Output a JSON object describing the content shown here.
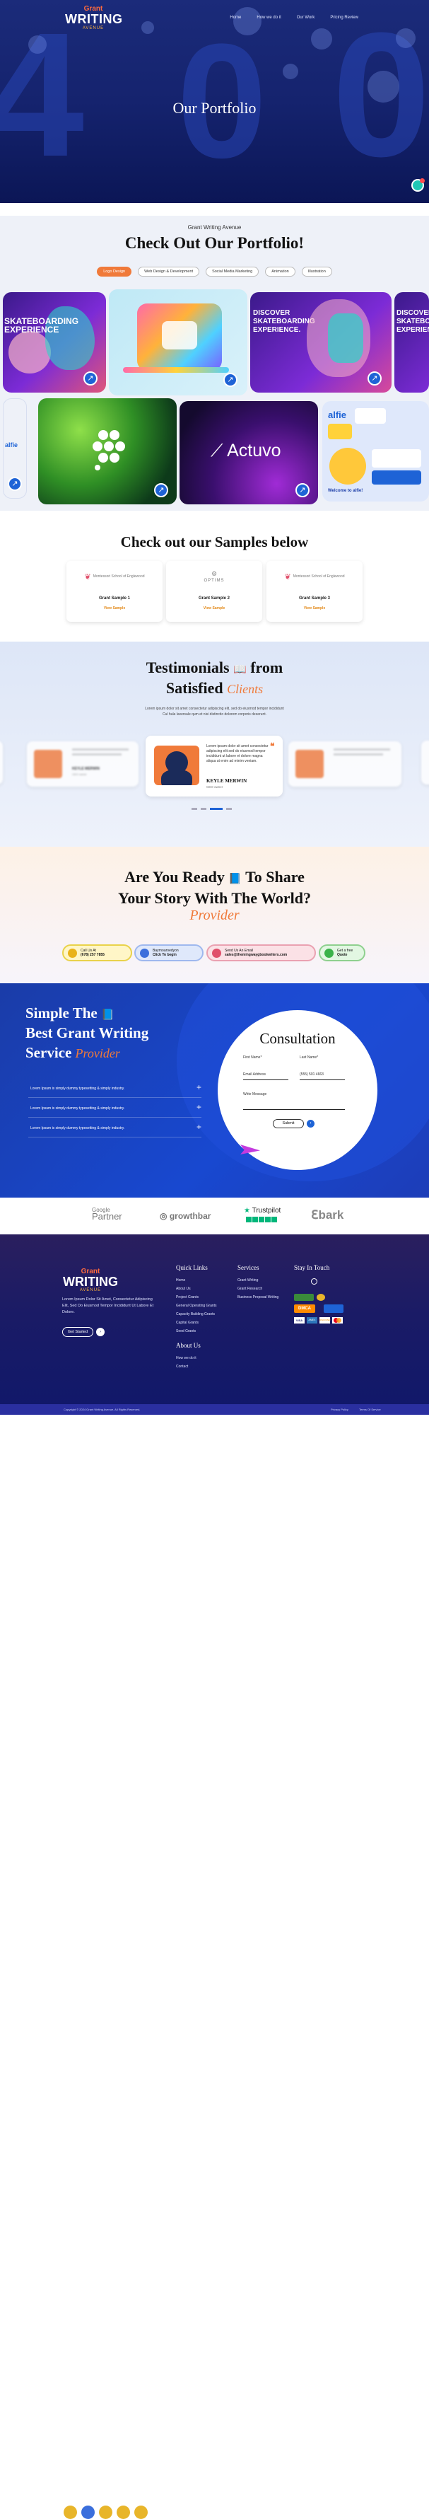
{
  "header": {
    "logo": {
      "line1": "Grant",
      "line2": "WRITING",
      "line3": "AVENUE"
    },
    "nav": [
      "Home",
      "How we do it",
      "Our Work",
      "Pricing Review"
    ],
    "title": "Our Portfolio"
  },
  "portfolio": {
    "eyebrow": "Grant Writing Avenue",
    "title": "Check Out Our Portfolio!",
    "filters": [
      "Logo Design",
      "Web Design & Development",
      "Social Media Marketing",
      "Animation",
      "Illustration"
    ],
    "active_filter": "Logo Design",
    "cards": {
      "skate_text": "DISCOVER SKATEBOARDING EXPERIENCE.",
      "skate_text_small": "SKATEBOARDING EXPERIENCE",
      "actuvo": "Actuvo",
      "alfie": "alfie",
      "alfie_side": "alfie",
      "welcome": "Welcome to alfie!"
    }
  },
  "samples": {
    "title": "Check out our Samples below",
    "items": [
      {
        "name": "Grant Sample 1",
        "link": "View Sample",
        "logo_text": "Montessori School of Englewood"
      },
      {
        "name": "Grant Sample 2",
        "link": "View Sample",
        "logo_text": "OPTIMS"
      },
      {
        "name": "Grant Sample 3",
        "link": "View Sample",
        "logo_text": "Montessori School of Englewood"
      }
    ]
  },
  "testimonials": {
    "title_line1": "Testimonials",
    "title_line1b": "from",
    "title_line2": "Satisfied",
    "script_word": "Clients",
    "intro_line1": "Lorem ipsum dolor sit amet consectetur adipiscing elit, sed do eiusmod tempor incididunt",
    "intro_line2": "Cul hula laversale qum et nisi distinctio dolorem corporis deserunt.",
    "featured": {
      "text": "Lorem ipsum dolor sit amet consectetur adipiscing elit sed do eiusmod tempor incididunt ut labore et dolore magna aliqua ut enim ad minim veniam.",
      "name": "KEYLE MERWIN",
      "role": "CEO owner"
    },
    "side_name": "KEYLE MERWIN",
    "side_role": "CEO owner",
    "dots_active": 2
  },
  "ready": {
    "line1": "Are You Ready",
    "line1b": "To Share",
    "line2": "Your Story With The World?",
    "script_word": "Provider",
    "pills": [
      {
        "label": "Call Us At",
        "value": "(678) 257 7855",
        "bg": "#fff6c7",
        "border": "#e9d24a",
        "icon": "#e9b21a"
      },
      {
        "label": "Bayrnoaroedyon",
        "value": "Click To begin",
        "bg": "#dfe8fb",
        "border": "#9fb8ee",
        "icon": "#3b6fdc"
      },
      {
        "label": "Send Us An Email",
        "value": "sales@themingwaygbootwriters.com",
        "bg": "#fbe1e6",
        "border": "#eaa1b1",
        "icon": "#e0506b"
      },
      {
        "label": "Get a free",
        "value": "Quote",
        "bg": "#e2f7e2",
        "border": "#8fd08f",
        "icon": "#3bb34a"
      }
    ]
  },
  "consult": {
    "title_line1": "Simple The",
    "title_line2": "Best Grant Writing",
    "title_line3": "Service",
    "script_word": "Provider",
    "accordion": [
      "Lorem Ipsum is simply dummy typesetting & simply industry.",
      "Lorem Ipsum is simply dummy typesetting & simply industry.",
      "Lorem Ipsum is simply dummy typesetting & simply industry."
    ],
    "form": {
      "title": "Consultation",
      "first_name_label": "First Name*",
      "last_name_label": "Last Name*",
      "email_placeholder": "Email Address",
      "phone_placeholder": "(555) 501 4663",
      "message_label": "Write Message",
      "submit": "Submit"
    }
  },
  "partners": [
    "Google Partner",
    "growthbar",
    "Trustpilot",
    "bark"
  ],
  "partners_google_top": "Google",
  "partners_google_bottom": "Partner",
  "footer": {
    "logo": {
      "line1": "Grant",
      "line2": "WRITING",
      "line3": "AVENUE"
    },
    "about": "Lorem Ipsum Dolor Sit Amet, Consectetur Adipiscing Elit, Sed Do Eiusmod Tempor Incididunt Ut Labore Et Dolore.",
    "get_started": "Get Started",
    "quick_links_title": "Quick Links",
    "quick_links": [
      "Home",
      "About Us",
      "Project Grants",
      "General Operating Grants",
      "Capacity Building Grants",
      "Capital Grants",
      "Seed Grants"
    ],
    "about_us_title": "About Us",
    "about_links": [
      "How we do it",
      "Contact"
    ],
    "services_title": "Services",
    "services": [
      "Grant Writing",
      "Grant Research",
      "Business Proposal Writing"
    ],
    "touch_title": "Stay In Touch",
    "bottom_left": "Copyright © 2024 Grant Writing Avenue. All Rights Reserved.",
    "bottom_right1": "Privacy Policy",
    "bottom_right2": "Terms Of Service",
    "payments": [
      "VISA",
      "AMEX",
      "DISCOVER"
    ],
    "dmca": "DMCA"
  }
}
